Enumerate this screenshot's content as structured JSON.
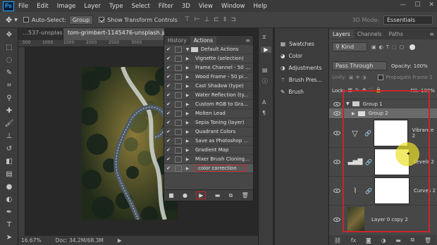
{
  "menubar": {
    "logo": "Ps",
    "items": [
      "File",
      "Edit",
      "Image",
      "Layer",
      "Type",
      "Select",
      "Filter",
      "3D",
      "View",
      "Window",
      "Help"
    ]
  },
  "optbar": {
    "auto_select": "Auto-Select:",
    "auto_select_value": "Group",
    "transform": "Show Transform Controls",
    "mode": "3D Mode:",
    "workspace": "Essentials"
  },
  "doc_tabs": [
    "…537-unsplash.jpg",
    "tom-grimbert-1145476-unsplash.jpg"
  ],
  "status": {
    "zoom": "16.67%",
    "doc": "Doc: 34.2M/68.3M"
  },
  "actions_panel": {
    "tabs": [
      "History",
      "Actions"
    ],
    "set_name": "Default Actions",
    "items": [
      "Vignette (selection)",
      "Frame Channel - 50 ...",
      "Wood Frame - 50 pi...",
      "Cast Shadow (type)",
      "Water Reflection (ty...",
      "Custom RGB to Gra...",
      "Molten Lead",
      "Sepia Toning (layer)",
      "Quadrant Colors",
      "Save as Photoshop ...",
      "Gradient Map",
      "Mixer Brush Cloning...",
      "color correction"
    ]
  },
  "side_panels": [
    "Swatches",
    "Color",
    "Adjustments",
    "Brush Pres...",
    "Brush"
  ],
  "layers_panel": {
    "tabs": [
      "Layers",
      "Channels",
      "Paths"
    ],
    "kind": "Kind",
    "blend": "Pass Through",
    "opacity_label": "Opacity:",
    "opacity": "100%",
    "unify": "Unify:",
    "propagate": "Propagate Frame 1",
    "lock": "Lock:",
    "fill_label": "Fill:",
    "fill": "100%",
    "layers": [
      "Group 1",
      "Group 2",
      "Vibrance 2",
      "Levels 2",
      "Curves 2",
      "Layer 0 copy 2"
    ]
  },
  "colors": {
    "accent": "#31a8ff",
    "highlight": "#c8262b"
  }
}
